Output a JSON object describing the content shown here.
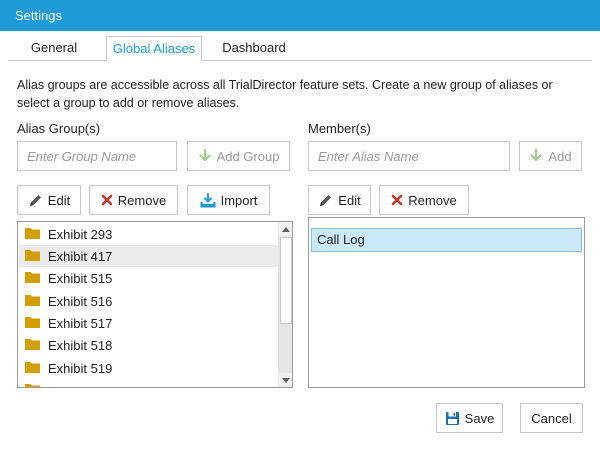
{
  "window": {
    "title": "Settings"
  },
  "tabs": [
    {
      "label": "General",
      "active": false
    },
    {
      "label": "Global Aliases",
      "active": true
    },
    {
      "label": "Dashboard",
      "active": false
    }
  ],
  "description": "Alias groups are accessible across all TrialDirector feature sets. Create a new group of aliases or select a group to add or remove aliases.",
  "groups": {
    "label": "Alias Group(s)",
    "input_placeholder": "Enter Group Name",
    "add_label": "Add Group",
    "edit_label": "Edit",
    "remove_label": "Remove",
    "import_label": "Import",
    "items": [
      "Exhibit 293",
      "Exhibit 417",
      "Exhibit 515",
      "Exhibit 516",
      "Exhibit 517",
      "Exhibit 518",
      "Exhibit 519"
    ],
    "hovered_item": "Exhibit 417"
  },
  "members": {
    "label": "Member(s)",
    "input_placeholder": "Enter Alias Name",
    "add_label": "Add",
    "edit_label": "Edit",
    "remove_label": "Remove",
    "items": [
      "Call Log"
    ],
    "selected_item": "Call Log"
  },
  "footer": {
    "save_label": "Save",
    "cancel_label": "Cancel"
  },
  "colors": {
    "accent": "#1f9bd8",
    "folder": "#d1a000",
    "remove": "#c0392b",
    "add_disabled": "#9fcf8e",
    "selection": "#cbe8f6"
  },
  "icons": {
    "edit": "pencil-icon",
    "remove": "x-icon",
    "import": "import-icon",
    "add": "arrow-down-icon",
    "save": "floppy-icon",
    "folder": "folder-icon"
  }
}
